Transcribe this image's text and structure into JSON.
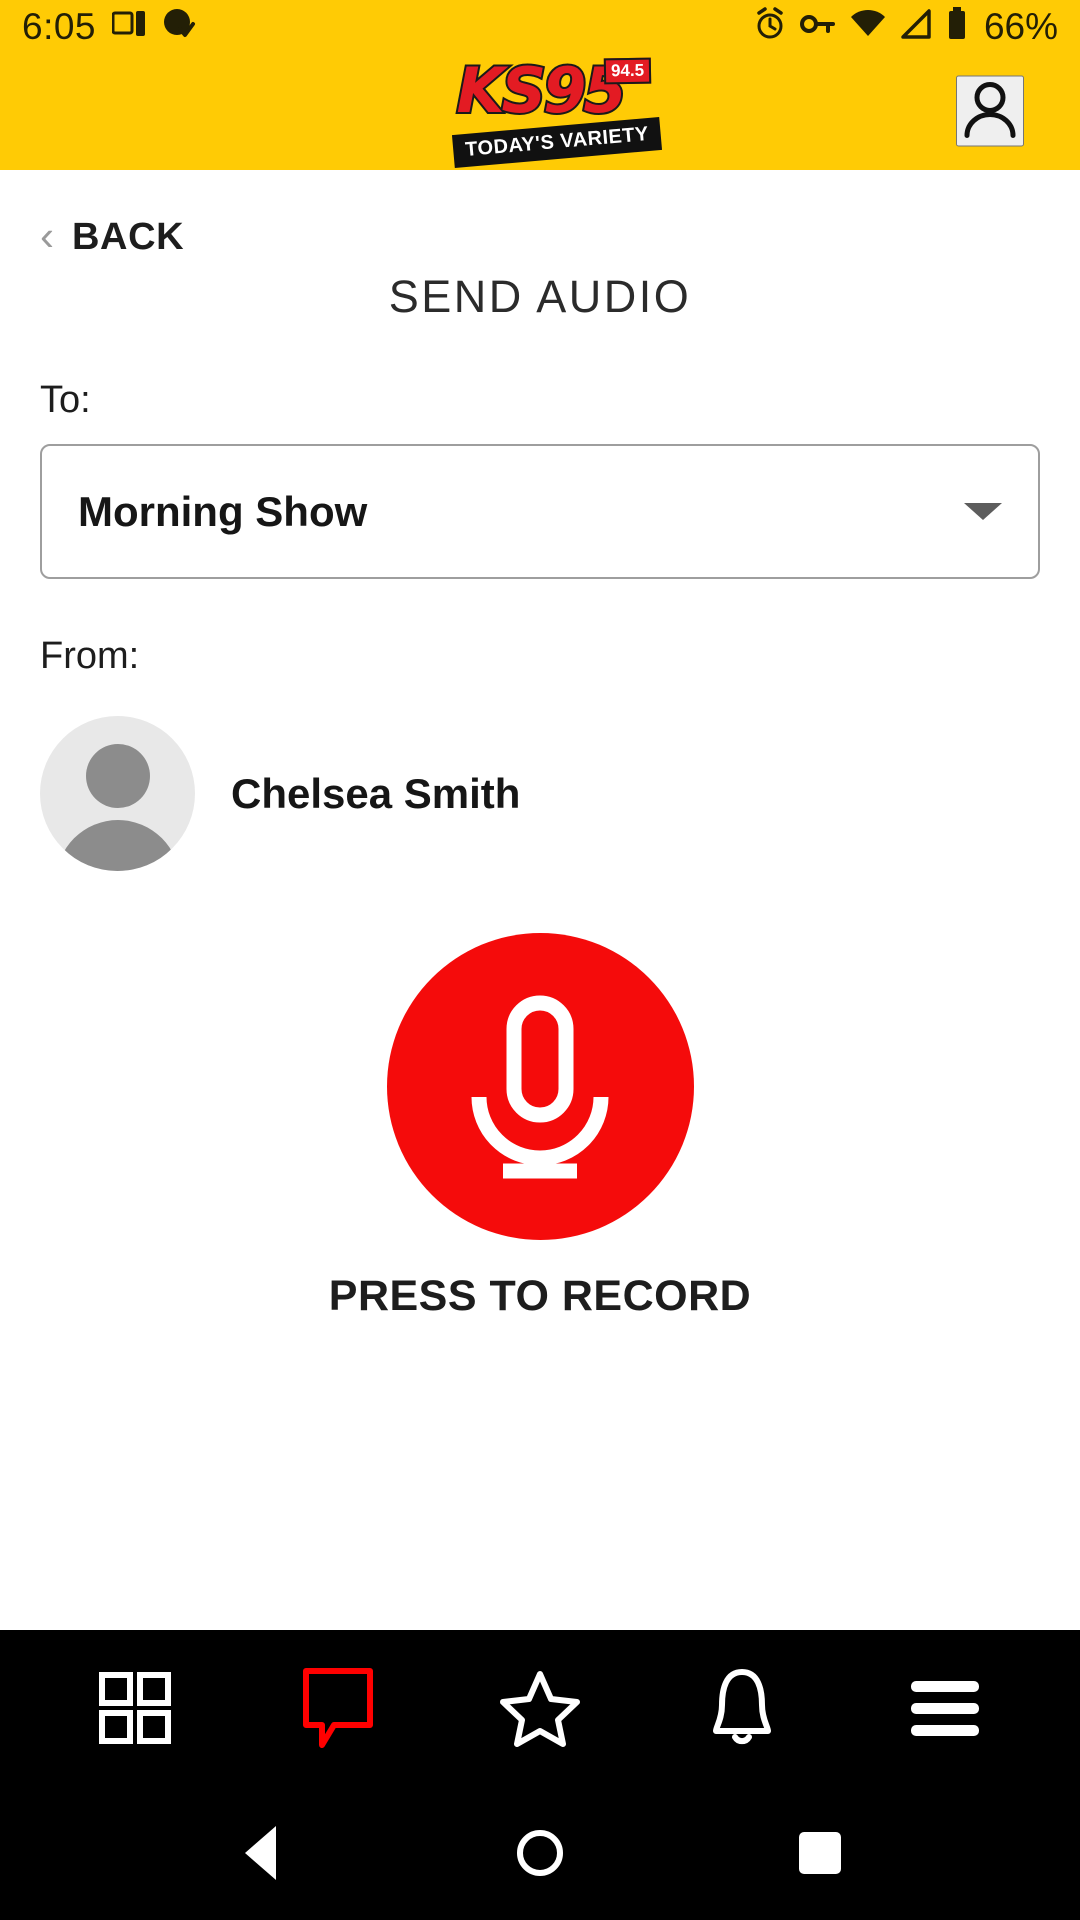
{
  "status_bar": {
    "time": "6:05",
    "battery_percent": "66%",
    "icons_left": [
      "cast-screen-icon",
      "app-check-icon"
    ],
    "icons_right": [
      "alarm-icon",
      "key-icon",
      "wifi-icon",
      "signal-icon",
      "battery-icon"
    ]
  },
  "brand_header": {
    "logo_text": "KS95",
    "logo_badge": "94.5",
    "logo_tagline": "TODAY'S VARIETY",
    "account_icon": "person-icon",
    "bg_color": "#FFCB05",
    "logo_red": "#E31B23"
  },
  "nav": {
    "back_label": "BACK",
    "back_icon": "chevron-left-icon"
  },
  "main": {
    "page_title": "SEND AUDIO",
    "to_label": "To:",
    "to_selected": "Morning Show",
    "to_options": [
      "Morning Show"
    ],
    "from_label": "From:",
    "from_name": "Chelsea Smith",
    "avatar_icon": "person-placeholder-icon",
    "record_button_icon": "microphone-icon",
    "record_label": "PRESS TO RECORD",
    "record_color": "#F50B0B"
  },
  "bottom_nav": {
    "items": [
      {
        "name": "grid-icon",
        "label": "Grid",
        "active": false
      },
      {
        "name": "speech-bubble-icon",
        "label": "Messages",
        "active": true
      },
      {
        "name": "star-icon",
        "label": "Favorites",
        "active": false
      },
      {
        "name": "bell-icon",
        "label": "Alerts",
        "active": false
      },
      {
        "name": "hamburger-menu-icon",
        "label": "Menu",
        "active": false
      }
    ],
    "active_color": "#FF0000",
    "inactive_color": "#FFFFFF",
    "bg_color": "#000000"
  },
  "system_nav": {
    "back": "system-back-icon",
    "home": "system-home-icon",
    "recents": "system-recents-icon"
  }
}
